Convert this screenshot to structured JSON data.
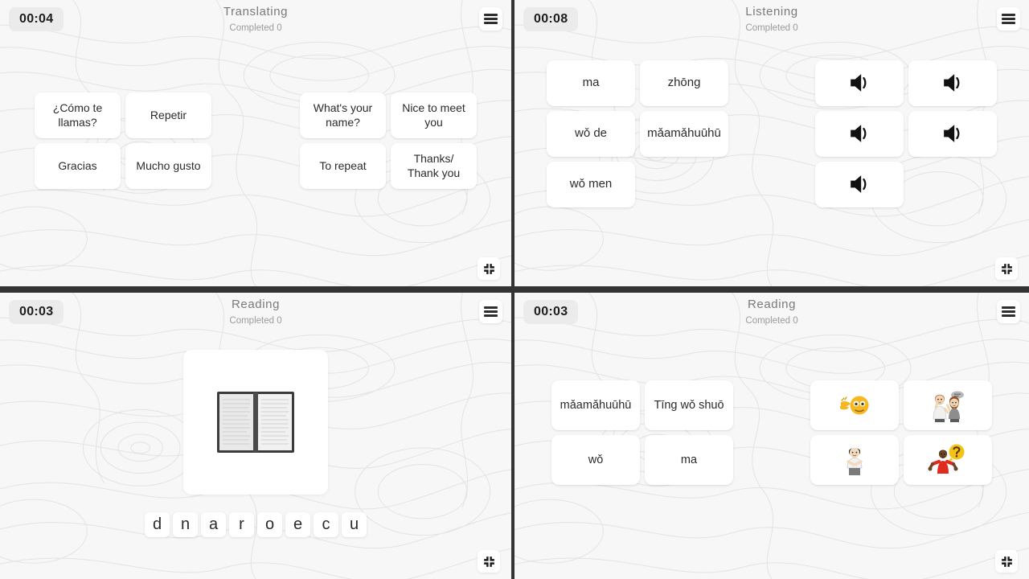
{
  "panels": [
    {
      "id": "translating",
      "timer": "00:04",
      "title": "Translating",
      "subtitle": "Completed 0",
      "menu_icon": "hamburger-menu-icon",
      "fullscreen_icon": "exit-fullscreen-icon",
      "left_column_a": [
        "¿Cómo te llamas?",
        "Gracias"
      ],
      "left_column_b": [
        "Repetir",
        "Mucho gusto"
      ],
      "right_column_a": [
        "What's your name?",
        "To repeat"
      ],
      "right_column_b": [
        "Nice to meet you",
        "Thanks/ Thank you"
      ]
    },
    {
      "id": "listening",
      "timer": "00:08",
      "title": "Listening",
      "subtitle": "Completed 0",
      "menu_icon": "hamburger-menu-icon",
      "fullscreen_icon": "exit-fullscreen-icon",
      "left_column_a": [
        "ma",
        "wǒ de",
        "wǒ men"
      ],
      "left_column_b": [
        "zhōng",
        "mǎamǎhuūhū"
      ],
      "right_column_a": [
        "speaker-icon",
        "speaker-icon",
        "speaker-icon"
      ],
      "right_column_b": [
        "speaker-icon",
        "speaker-icon"
      ]
    },
    {
      "id": "reading-anagram",
      "timer": "00:03",
      "title": "Reading",
      "subtitle": "Completed 0",
      "menu_icon": "hamburger-menu-icon",
      "fullscreen_icon": "exit-fullscreen-icon",
      "image_icon": "open-book-icon",
      "letters": [
        "d",
        "n",
        "a",
        "r",
        "o",
        "e",
        "c",
        "u"
      ]
    },
    {
      "id": "reading-pictures",
      "timer": "00:03",
      "title": "Reading",
      "subtitle": "Completed 0",
      "menu_icon": "hamburger-menu-icon",
      "fullscreen_icon": "exit-fullscreen-icon",
      "left_column_a": [
        "mǎamǎhuūhū",
        "wǒ"
      ],
      "left_column_b": [
        "Tīng wǒ shuō",
        "ma"
      ],
      "right_column_a": [
        "hear-with-hand-emoji",
        "self-pointing-person-emoji"
      ],
      "right_column_b": [
        "two-women-talking-emoji",
        "person-shrugging-question-emoji"
      ]
    }
  ],
  "colors": {
    "panel_background": "#f7f7f7",
    "gutter": "#333333",
    "card_background": "#ffffff",
    "timer_pill": "#ebebeb",
    "title_text": "#7a7a7a",
    "body_text": "#2b2b2b"
  }
}
